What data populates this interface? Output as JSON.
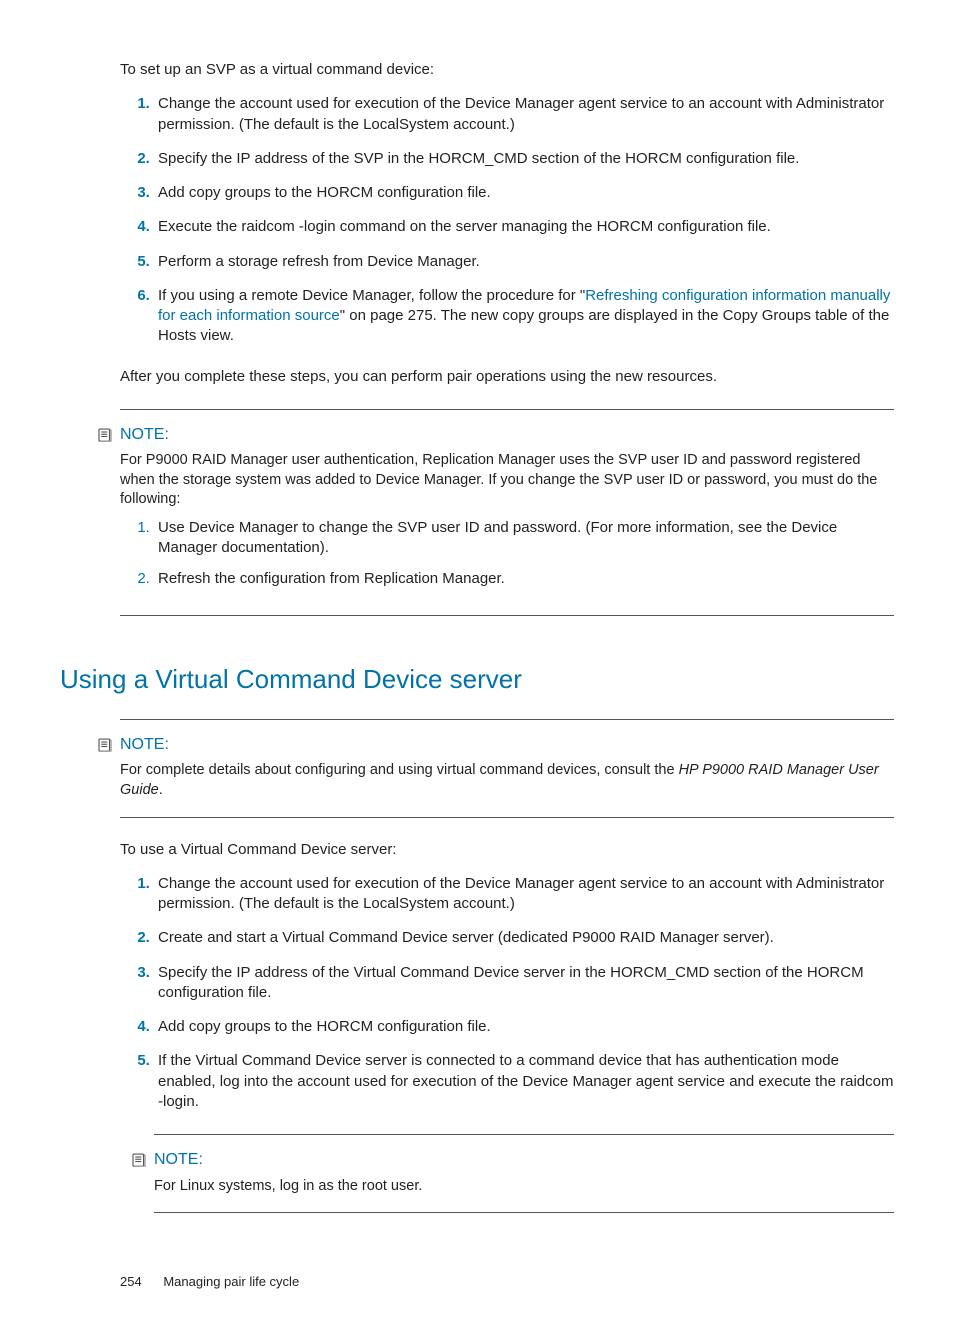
{
  "intro1": "To set up an SVP as a virtual command device:",
  "list1": {
    "i1": "Change the account used for execution of the Device Manager agent service to an account with Administrator permission. (The default is the LocalSystem account.)",
    "i2a": "Specify the IP address of the SVP in the ",
    "i2b": "HORCM_CMD",
    "i2c": " section of the HORCM configuration file.",
    "i3": "Add copy groups to the HORCM configuration file.",
    "i4a": "Execute the ",
    "i4b": "raidcom -login",
    "i4c": " command on the server managing the HORCM configuration file.",
    "i5": "Perform a storage refresh from Device Manager.",
    "i6a": "If you using a remote Device Manager, follow the procedure for \"",
    "i6link": "Refreshing configuration information manually for each information source",
    "i6b": "\" on page 275. The new copy groups are displayed in the Copy Groups table of the Hosts view."
  },
  "after1": "After you complete these steps, you can perform pair operations using the new resources.",
  "note1": {
    "label": "NOTE:",
    "body": "For P9000 RAID Manager user authentication, Replication Manager uses the SVP user ID and password registered when the storage system was added to Device Manager. If you change the SVP user ID or password, you must do the following:",
    "s1": "Use Device Manager to change the SVP user ID and password. (For more information, see the Device Manager documentation).",
    "s2": "Refresh the configuration from Replication Manager."
  },
  "section2": "Using a Virtual Command Device server",
  "note2": {
    "label": "NOTE:",
    "body_a": "For complete details about configuring and using virtual command devices, consult the ",
    "body_i": "HP P9000 RAID Manager User Guide",
    "body_b": "."
  },
  "intro2": "To use a Virtual Command Device server:",
  "list2": {
    "i1": "Change the account used for execution of the Device Manager agent service to an account with Administrator permission. (The default is the LocalSystem account.)",
    "i2": "Create and start a Virtual Command Device server (dedicated P9000 RAID Manager server).",
    "i3a": "Specify the IP address of the Virtual Command Device server in the ",
    "i3b": "HORCM_CMD",
    "i3c": " section of the HORCM configuration file.",
    "i4": "Add copy groups to the HORCM configuration file.",
    "i5a": "If the Virtual Command Device server is connected to a command device that has authentication mode enabled, log into the account used for execution of the Device Manager agent service and execute the ",
    "i5b": "raidcom -login",
    "i5c": "."
  },
  "note3": {
    "label": "NOTE:",
    "body": "For Linux systems, log in as the root user."
  },
  "footer": {
    "page": "254",
    "title": "Managing pair life cycle"
  }
}
